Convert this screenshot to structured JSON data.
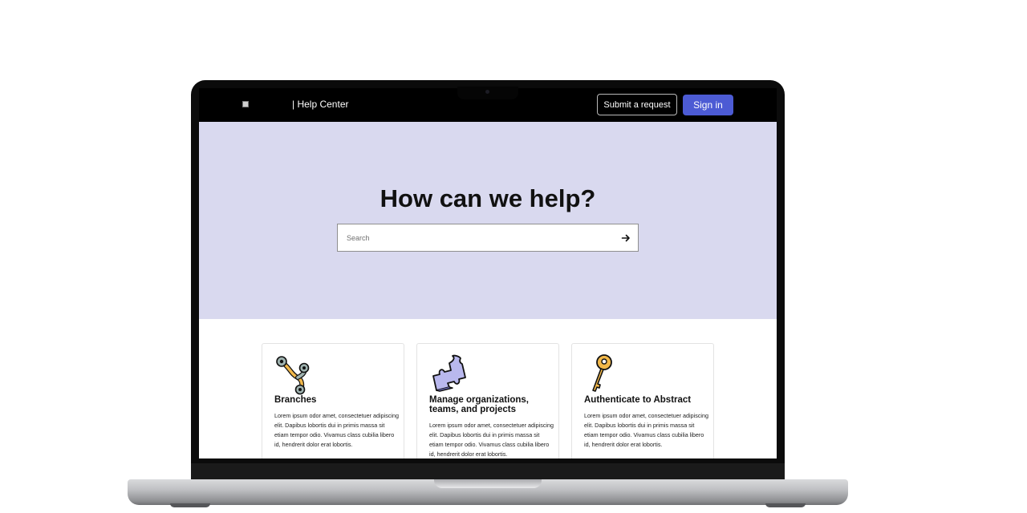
{
  "header": {
    "title": "| Help Center",
    "submit_label": "Submit a request",
    "signin_label": "Sign in"
  },
  "hero": {
    "title": "How can we help?",
    "search_placeholder": "Search"
  },
  "cards": [
    {
      "title": "Branches",
      "body": "Lorem ipsum odor amet, consectetuer adipiscing elit. Dapibus lobortis dui in primis massa sit etiam tempor odio. Vivamus class cubilia libero id, hendrerit dolor erat lobortis.",
      "icon": "branches-icon"
    },
    {
      "title": "Manage organizations, teams, and projects",
      "body": "Lorem ipsum odor amet, consectetuer adipiscing elit. Dapibus lobortis dui in primis massa sit etiam tempor odio. Vivamus class cubilia libero id, hendrerit dolor erat lobortis.",
      "icon": "puzzle-piece-icon"
    },
    {
      "title": "Authenticate to Abstract",
      "body": "Lorem ipsum odor amet, consectetuer adipiscing elit. Dapibus lobortis dui in primis massa sit etiam tempor odio. Vivamus class cubilia libero id, hendrerit dolor erat lobortis.",
      "icon": "key-icon"
    }
  ],
  "colors": {
    "header_bg": "#000000",
    "hero_bg": "#d9d9ef",
    "signin_bg": "#4c5bd4"
  }
}
